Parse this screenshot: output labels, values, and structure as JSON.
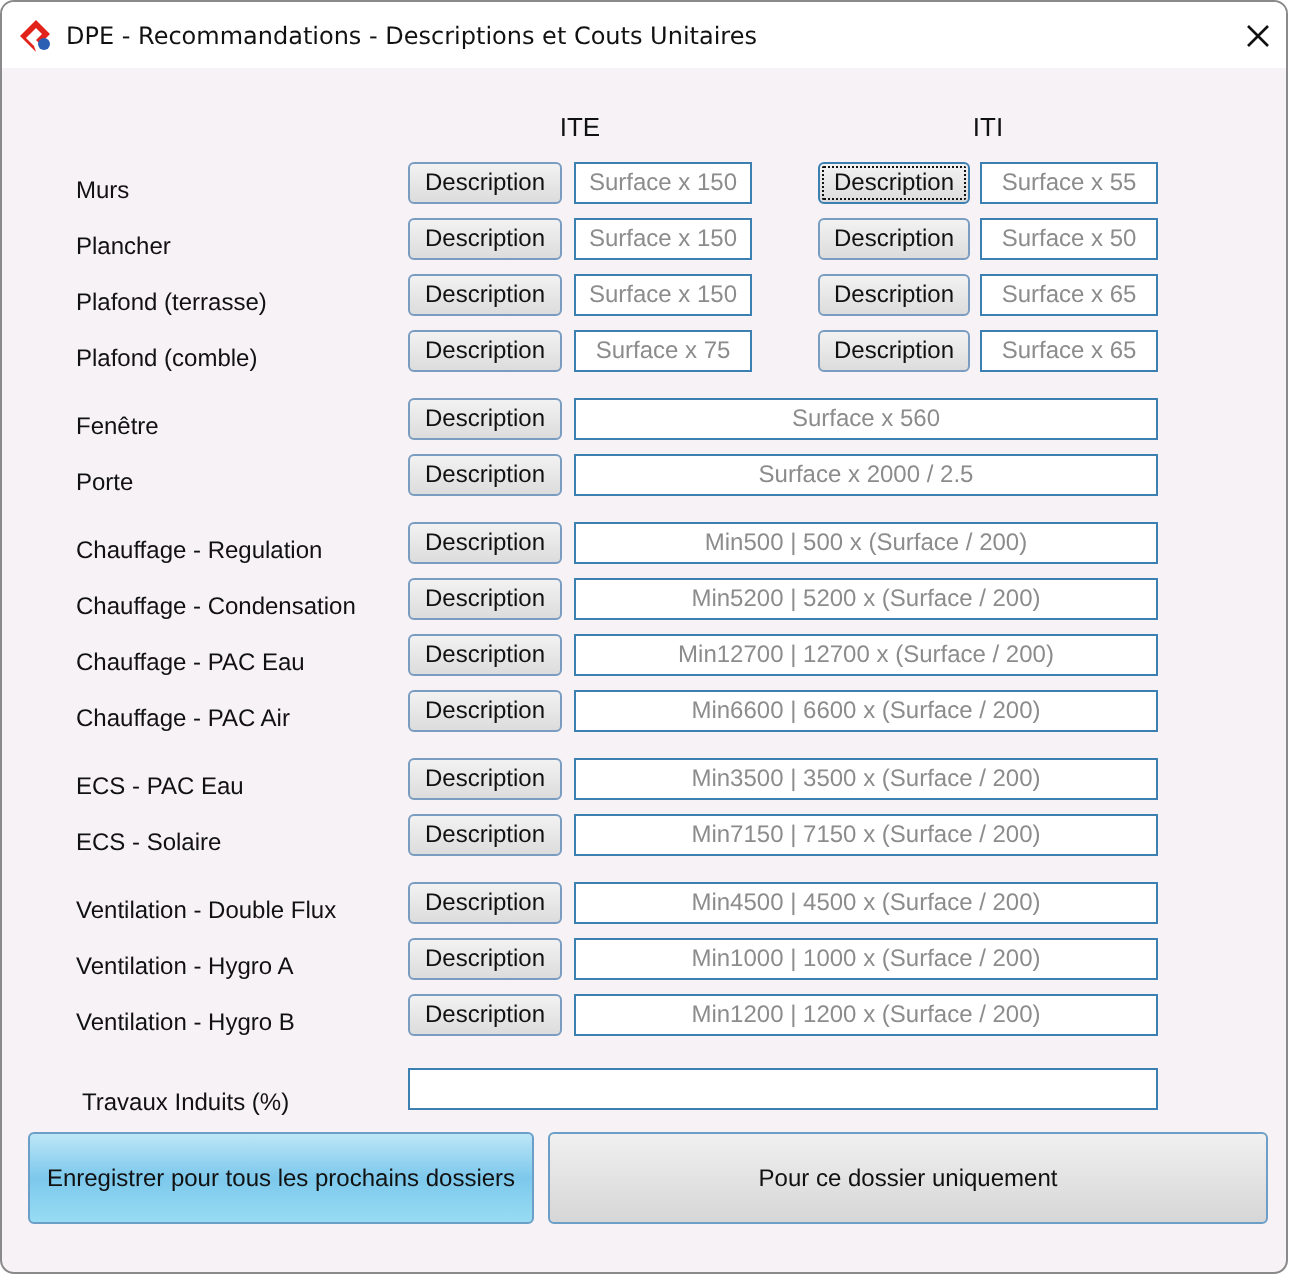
{
  "window": {
    "title": "DPE - Recommandations - Descriptions et Couts Unitaires"
  },
  "columns": [
    "ITE",
    "ITI"
  ],
  "groups": [
    {
      "rows": [
        {
          "label": "Murs",
          "kind": "split",
          "cells": [
            {
              "button": "Description",
              "focused": false,
              "placeholder": "Surface x 150"
            },
            {
              "button": "Description",
              "focused": true,
              "placeholder": "Surface x 55"
            }
          ]
        },
        {
          "label": "Plancher",
          "kind": "split",
          "cells": [
            {
              "button": "Description",
              "focused": false,
              "placeholder": "Surface x 150"
            },
            {
              "button": "Description",
              "focused": false,
              "placeholder": "Surface x 50"
            }
          ]
        },
        {
          "label": "Plafond (terrasse)",
          "kind": "split",
          "cells": [
            {
              "button": "Description",
              "focused": false,
              "placeholder": "Surface x 150"
            },
            {
              "button": "Description",
              "focused": false,
              "placeholder": "Surface x 65"
            }
          ]
        },
        {
          "label": "Plafond (comble)",
          "kind": "split",
          "cells": [
            {
              "button": "Description",
              "focused": false,
              "placeholder": "Surface x 75"
            },
            {
              "button": "Description",
              "focused": false,
              "placeholder": "Surface x 65"
            }
          ]
        }
      ]
    },
    {
      "rows": [
        {
          "label": "Fenêtre",
          "kind": "wide",
          "cells": [
            {
              "button": "Description",
              "focused": false,
              "placeholder": "Surface x 560"
            }
          ]
        },
        {
          "label": "Porte",
          "kind": "wide",
          "cells": [
            {
              "button": "Description",
              "focused": false,
              "placeholder": "Surface x 2000 / 2.5"
            }
          ]
        }
      ]
    },
    {
      "rows": [
        {
          "label": "Chauffage - Regulation",
          "kind": "wide",
          "cells": [
            {
              "button": "Description",
              "focused": false,
              "placeholder": "Min500 | 500 x (Surface / 200)"
            }
          ]
        },
        {
          "label": "Chauffage - Condensation",
          "kind": "wide",
          "cells": [
            {
              "button": "Description",
              "focused": false,
              "placeholder": "Min5200 | 5200 x (Surface / 200)"
            }
          ]
        },
        {
          "label": "Chauffage - PAC Eau",
          "kind": "wide",
          "cells": [
            {
              "button": "Description",
              "focused": false,
              "placeholder": "Min12700 | 12700 x (Surface / 200)"
            }
          ]
        },
        {
          "label": "Chauffage - PAC Air",
          "kind": "wide",
          "cells": [
            {
              "button": "Description",
              "focused": false,
              "placeholder": "Min6600 | 6600 x (Surface / 200)"
            }
          ]
        }
      ]
    },
    {
      "rows": [
        {
          "label": "ECS - PAC Eau",
          "kind": "wide",
          "cells": [
            {
              "button": "Description",
              "focused": false,
              "placeholder": "Min3500 | 3500 x (Surface / 200)"
            }
          ]
        },
        {
          "label": "ECS - Solaire",
          "kind": "wide",
          "cells": [
            {
              "button": "Description",
              "focused": false,
              "placeholder": "Min7150 | 7150 x (Surface / 200)"
            }
          ]
        }
      ]
    },
    {
      "rows": [
        {
          "label": "Ventilation - Double Flux",
          "kind": "wide",
          "cells": [
            {
              "button": "Description",
              "focused": false,
              "placeholder": "Min4500 | 4500 x (Surface / 200)"
            }
          ]
        },
        {
          "label": "Ventilation - Hygro A",
          "kind": "wide",
          "cells": [
            {
              "button": "Description",
              "focused": false,
              "placeholder": "Min1000 | 1000 x (Surface / 200)"
            }
          ]
        },
        {
          "label": "Ventilation - Hygro B",
          "kind": "wide",
          "cells": [
            {
              "button": "Description",
              "focused": false,
              "placeholder": "Min1200 | 1200 x (Surface / 200)"
            }
          ]
        }
      ]
    }
  ],
  "travaux": {
    "label": "Travaux Induits (%)"
  },
  "buttons": [
    {
      "label": "Enregistrer pour tous les prochains dossiers",
      "default": true
    },
    {
      "label": "Pour ce dossier uniquement",
      "default": false
    }
  ]
}
